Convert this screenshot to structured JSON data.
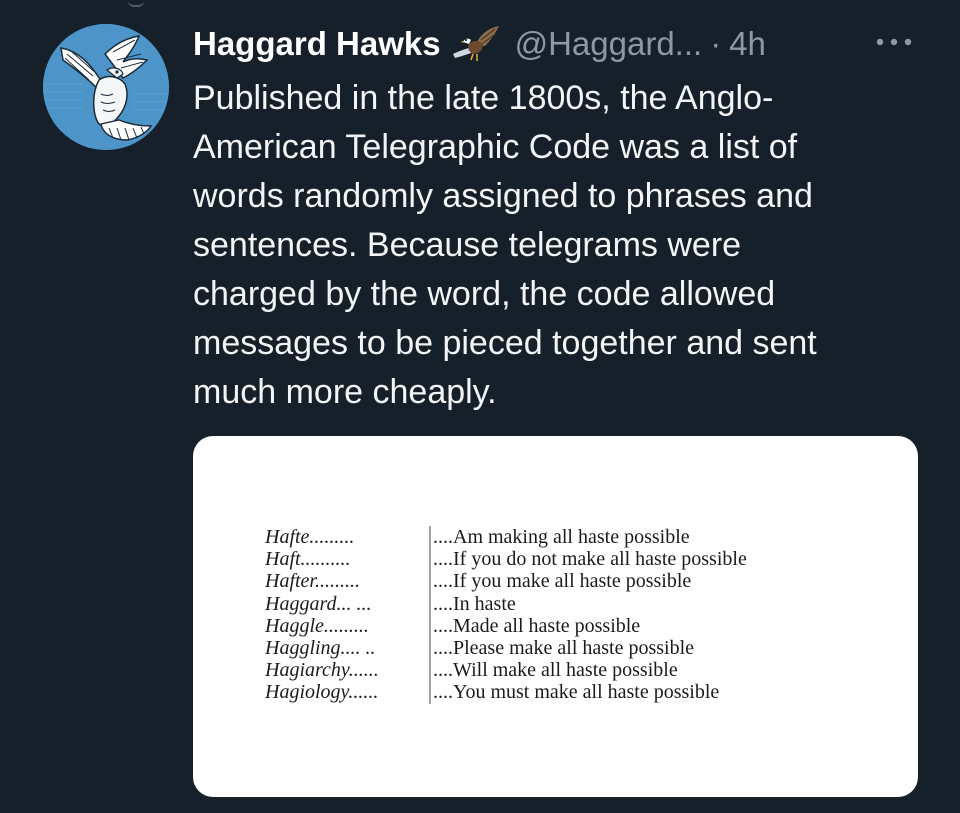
{
  "tweet": {
    "display_name": "Haggard Hawks",
    "badge_icon": "hawk-emoji-icon",
    "handle": "@Haggard...",
    "separator": "·",
    "timestamp": "4h",
    "more_icon": "more-horizontal-icon",
    "avatar_icon": "hawk-illustration-avatar",
    "text_lines": [
      "Published in the late 1800s, the Anglo-",
      "American Telegraphic Code was a list of",
      "words randomly assigned to phrases and",
      "sentences. Because telegrams were",
      "charged by the word, the code allowed",
      "messages to be pieced together and sent",
      "much more cheaply."
    ]
  },
  "media": {
    "rows": [
      {
        "word": "Hafte.........",
        "meaning": "....Am making all haste possible"
      },
      {
        "word": "Haft..........",
        "meaning": "....If you do not make all haste possible"
      },
      {
        "word": "Hafter.........",
        "meaning": "....If you make all haste possible"
      },
      {
        "word": "Haggard... ...",
        "meaning": "....In haste"
      },
      {
        "word": "Haggle.........",
        "meaning": "....Made all haste possible"
      },
      {
        "word": "Haggling.... ..",
        "meaning": "....Please make all haste possible"
      },
      {
        "word": "Hagiarchy......",
        "meaning": "....Will make all haste possible"
      },
      {
        "word": "Hagiology......",
        "meaning": "....You must make all haste possible"
      }
    ]
  },
  "colors": {
    "background": "#15202b",
    "primary_text": "#ffffff",
    "secondary_text": "#8b98a5",
    "avatar_blue": "#4d94c8",
    "card": "#ffffff"
  }
}
